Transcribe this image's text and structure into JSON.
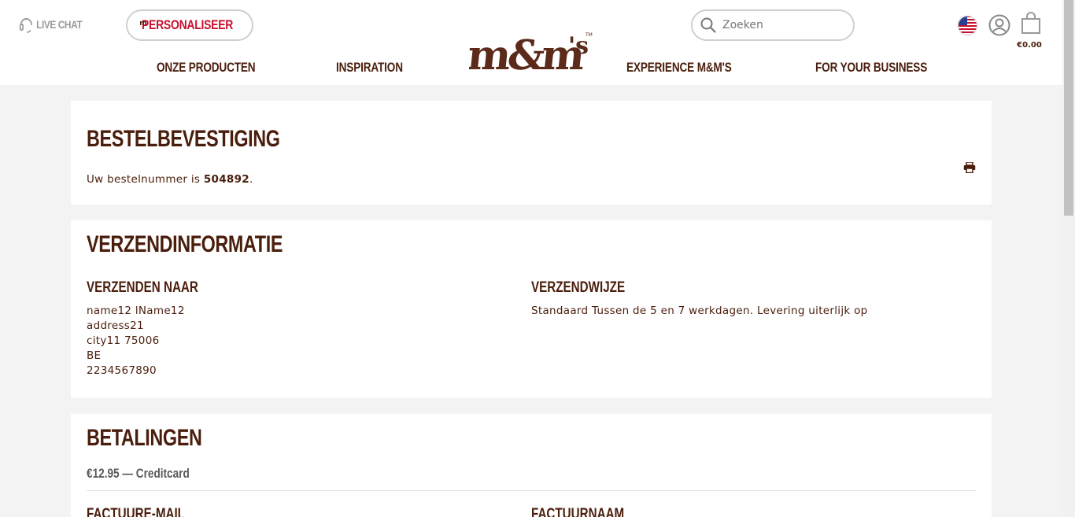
{
  "header": {
    "live_chat_label": "LIVE CHAT",
    "personalize_label": "PERSONALISEER",
    "badge_letter": "m",
    "search_placeholder": "Zoeken",
    "cart_total": "€0.00",
    "nav": [
      "ONZE PRODUCTEN",
      "INSPIRATION",
      "EXPERIENCE M&M'S",
      "FOR YOUR BUSINESS"
    ],
    "logo_icon": "mms-logo",
    "flag_icon": "us-flag-icon"
  },
  "confirmation": {
    "title": "BESTELBEVESTIGING",
    "order_prefix": "Uw bestelnummer is ",
    "order_number": "504892",
    "order_suffix": "."
  },
  "shipping": {
    "title": "VERZENDINFORMATIE",
    "ship_to_heading": "VERZENDEN NAAR",
    "address_lines": [
      "name12 lName12",
      "address21",
      "city11 75006",
      "BE",
      "2234567890"
    ],
    "method_heading": "VERZENDWIJZE",
    "method_text": "Standaard Tussen de 5 en 7 werkdagen. Levering uiterlijk op"
  },
  "payments": {
    "title": "BETALINGEN",
    "amount": "€12.95",
    "separator": " — ",
    "method": "Creditcard",
    "billing_email_heading": "FACTUURE-MAIL",
    "billing_name_heading": "FACTUURNAAM"
  },
  "colors": {
    "brand_brown": "#4a1e0c",
    "accent_red": "#c8102e",
    "background": "#f3f3f3"
  }
}
